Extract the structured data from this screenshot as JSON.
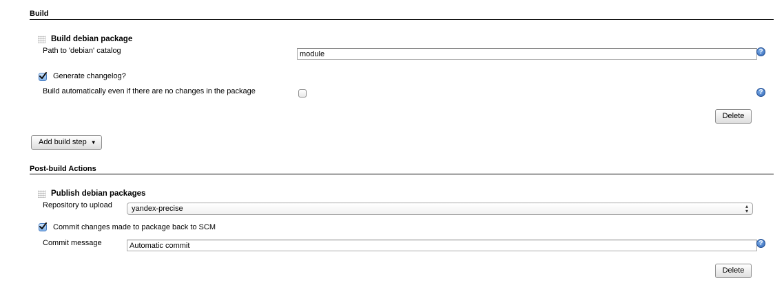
{
  "build_section": {
    "title": "Build",
    "step": {
      "title": "Build debian package",
      "path_label": "Path to 'debian' catalog",
      "path_value": "module",
      "changelog_label": "Generate changelog?",
      "changelog_checked": true,
      "auto_build_label": "Build automatically even if there are no changes in the package",
      "auto_build_checked": false,
      "delete_label": "Delete",
      "help_glyph": "?"
    },
    "add_step_label": "Add build step",
    "add_step_arrow": "▼"
  },
  "post_build_section": {
    "title": "Post-build Actions",
    "step": {
      "title": "Publish debian packages",
      "repo_label": "Repository to upload",
      "repo_value": "yandex-precise",
      "commit_label": "Commit changes made to package back to SCM",
      "commit_checked": true,
      "message_label": "Commit message",
      "message_value": "Automatic commit",
      "delete_label": "Delete",
      "help_glyph": "?"
    }
  },
  "icons": {
    "drag_handle": "drag-handle-icon",
    "help": "help-icon",
    "checkmark": "check-icon",
    "dropdown": "chevron-down-icon",
    "select_arrows": "up-down-arrows-icon"
  },
  "colors": {
    "help_blue": "#2f64b5",
    "checkbox_blue": "#4b7fc2",
    "rule": "#000000"
  }
}
